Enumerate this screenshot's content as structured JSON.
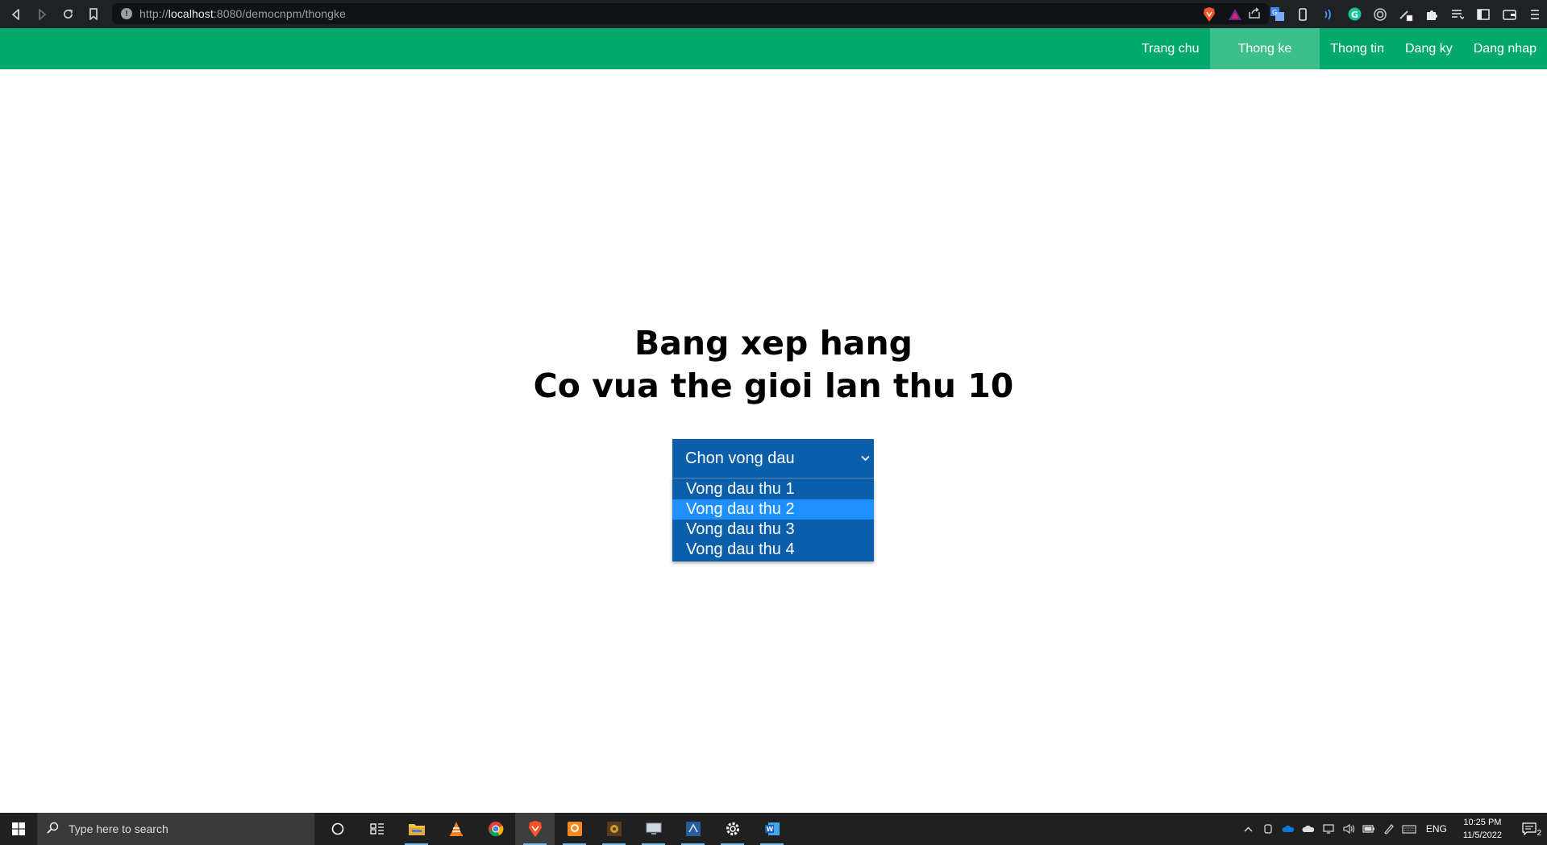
{
  "browser": {
    "url_prefix": "http://",
    "url_host": "localhost",
    "url_rest": ":8080/democnpm/thongke"
  },
  "site": {
    "nav": [
      "Trang chu",
      "Thong ke",
      "Thong tin",
      "Dang ky",
      "Dang nhap"
    ],
    "active_nav": "Thong ke"
  },
  "main": {
    "title_line1": "Bang xep hang",
    "title_line2": "Co vua the gioi lan thu 10",
    "select": {
      "selected_label": "Chon vong dau",
      "options": [
        "Vong dau thu 1",
        "Vong dau thu 2",
        "Vong dau thu 3",
        "Vong dau thu 4"
      ],
      "highlighted": "Vong dau thu 2"
    }
  },
  "taskbar": {
    "search_placeholder": "Type here to search",
    "language": "ENG",
    "time": "10:25 PM",
    "date": "11/5/2022",
    "notification_count": "2"
  },
  "colors": {
    "header_green": "#04aa6d",
    "active_nav_bg": "#3cbf8b",
    "select_blue": "#0b5ea9",
    "option_highlight": "#1e90ff"
  }
}
